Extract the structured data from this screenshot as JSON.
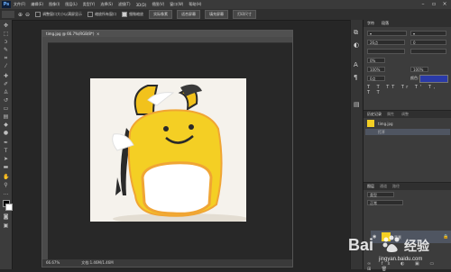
{
  "app": {
    "logo": "Ps"
  },
  "menu": [
    "文件(F)",
    "编辑(E)",
    "图像(I)",
    "图层(L)",
    "类型(Y)",
    "选择(S)",
    "滤镜(T)",
    "3D(D)",
    "视图(V)",
    "窗口(W)",
    "帮助(H)"
  ],
  "options": {
    "check1": "调整窗口大小以满屏显示",
    "check2": "缩放所有窗口",
    "check3": "细微缩放",
    "btn1": "实际像素",
    "btn2": "适合屏幕",
    "btn3": "填充屏幕",
    "btn4": "打印尺寸"
  },
  "document": {
    "title": "timg.jpg @ 66.7%(RGB/8*)",
    "zoom": "66.67%",
    "docsize": "文档:1.46M/1.46M"
  },
  "character": {
    "tab1": "字符",
    "tab2": "段落",
    "font_size": "26点",
    "leading": "0",
    "scale_v": "100%",
    "scale_h": "100%",
    "tracking": "0%",
    "baseline": "0点",
    "color_label": "颜色:"
  },
  "history": {
    "tab1": "历史记录",
    "tab2": "属性",
    "tab3": "调整",
    "file": "timg.jpg",
    "state": "打开"
  },
  "layers": {
    "tab1": "图层",
    "tab2": "通道",
    "tab3": "路径",
    "kind": "类型",
    "mode": "正常",
    "layer_name": "背景"
  },
  "watermark": {
    "brand_a": "Bai",
    "brand_b": "经验",
    "site": "jingyan.baidu.com"
  },
  "colors": {
    "accent": "#2a3aa8",
    "bg": "#262626",
    "panel": "#3c3c3c"
  }
}
